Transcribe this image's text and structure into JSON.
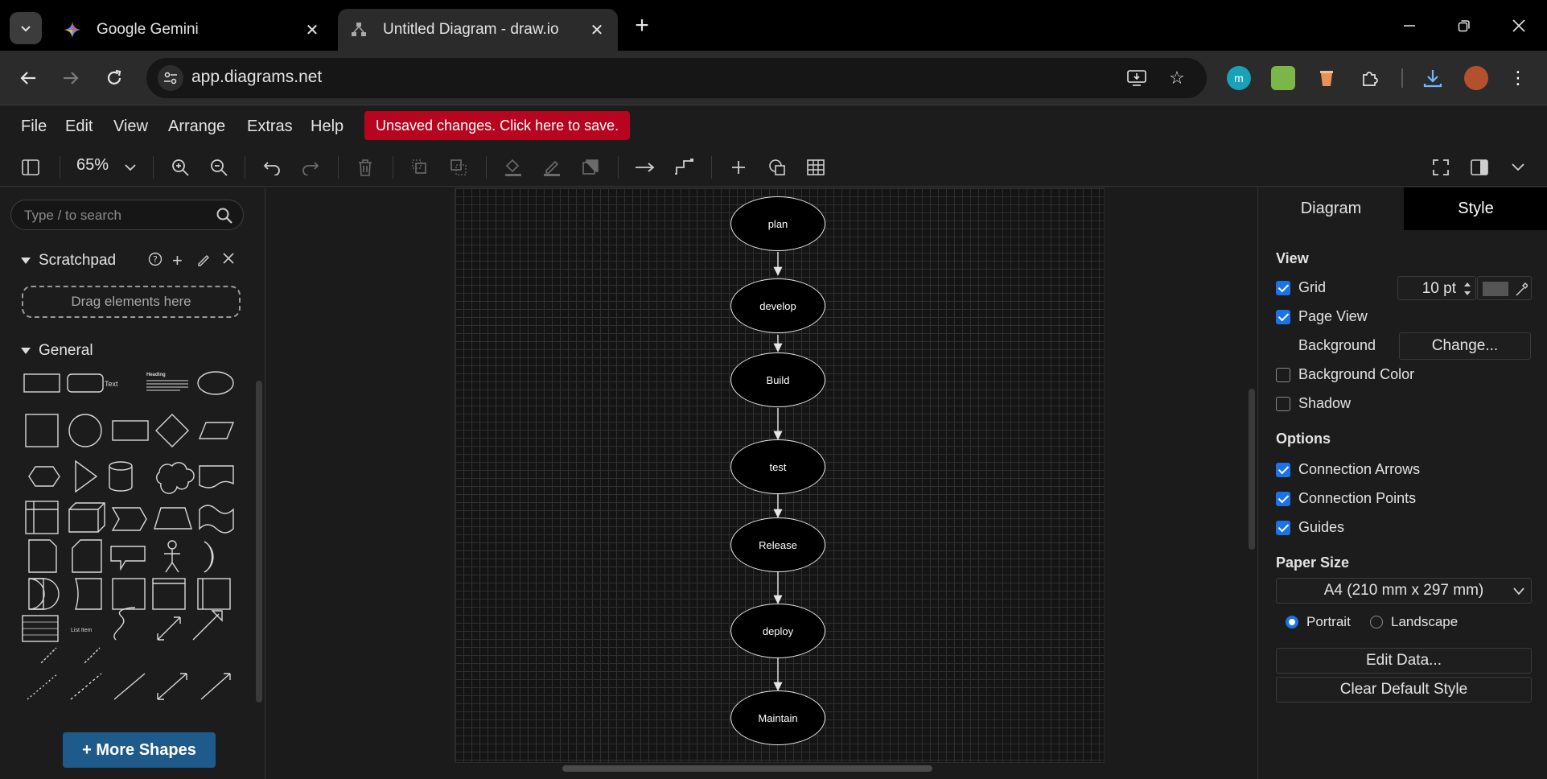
{
  "browser": {
    "tabs": [
      {
        "title": "Google Gemini",
        "active": false
      },
      {
        "title": "Untitled Diagram - draw.io",
        "active": true
      }
    ],
    "url": "app.diagrams.net",
    "extensions": [
      "m"
    ]
  },
  "menu": {
    "items": [
      "File",
      "Edit",
      "View",
      "Arrange",
      "Extras",
      "Help"
    ],
    "unsaved_label": "Unsaved changes. Click here to save."
  },
  "toolbar": {
    "zoom": "65%"
  },
  "sidebar": {
    "search_placeholder": "Type / to search",
    "scratchpad_title": "Scratchpad",
    "drag_hint": "Drag elements here",
    "general_title": "General",
    "text_shape": "Text",
    "heading_shape": "Heading",
    "list_item_shape": "List Item",
    "more_shapes": "+ More Shapes"
  },
  "diagram": {
    "nodes": [
      "plan",
      "develop",
      "Build",
      "test",
      "Release",
      "deploy",
      "Maintain"
    ]
  },
  "format_panel": {
    "tabs": [
      "Diagram",
      "Style"
    ],
    "view_title": "View",
    "grid_label": "Grid",
    "grid_size": "10 pt",
    "page_view_label": "Page View",
    "background_label": "Background",
    "change_button": "Change...",
    "background_color_label": "Background Color",
    "shadow_label": "Shadow",
    "options_title": "Options",
    "connection_arrows_label": "Connection Arrows",
    "connection_points_label": "Connection Points",
    "guides_label": "Guides",
    "paper_size_title": "Paper Size",
    "paper_size_value": "A4 (210 mm x 297 mm)",
    "portrait_label": "Portrait",
    "landscape_label": "Landscape",
    "edit_data_button": "Edit Data...",
    "clear_style_button": "Clear Default Style"
  },
  "colors": {
    "unsaved_bg": "#b7051f",
    "checkbox_on": "#1a73e8",
    "more_shapes_bg": "#1e5a8a"
  }
}
